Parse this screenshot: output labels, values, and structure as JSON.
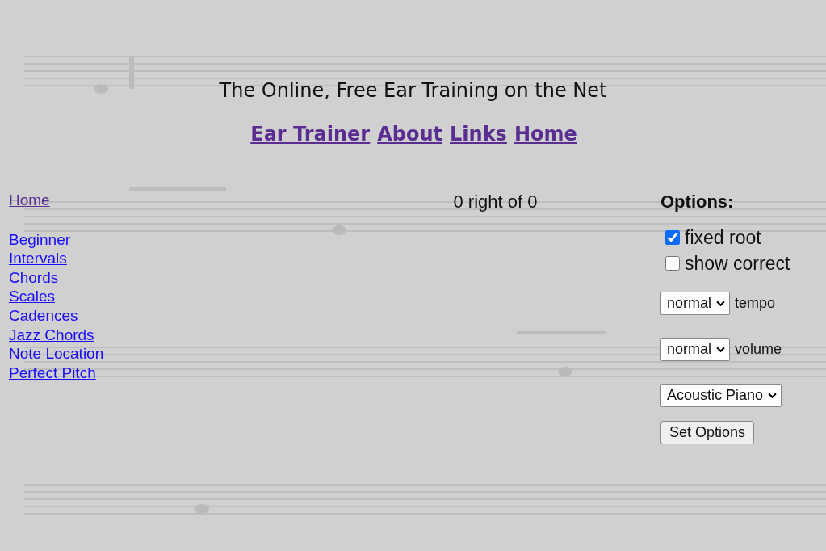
{
  "title": "The Online, Free Ear Training on the Net",
  "nav": [
    {
      "label": "Ear Trainer",
      "visited": true
    },
    {
      "label": "About",
      "visited": true
    },
    {
      "label": "Links",
      "visited": true
    },
    {
      "label": "Home",
      "visited": true
    }
  ],
  "sidebar": {
    "home": {
      "label": "Home",
      "visited": true
    },
    "items": [
      {
        "label": "Beginner",
        "visited": false
      },
      {
        "label": "Intervals",
        "visited": false
      },
      {
        "label": "Chords",
        "visited": false
      },
      {
        "label": "Scales",
        "visited": false
      },
      {
        "label": "Cadences",
        "visited": false
      },
      {
        "label": "Jazz Chords",
        "visited": false
      },
      {
        "label": "Note Location",
        "visited": false
      },
      {
        "label": "Perfect Pitch",
        "visited": false
      }
    ]
  },
  "score": "0 right of 0",
  "options": {
    "heading": "Options:",
    "checkboxes": [
      {
        "label": "fixed root",
        "checked": true
      },
      {
        "label": "show correct",
        "checked": false
      }
    ],
    "selects": [
      {
        "value": "normal",
        "label": "tempo"
      },
      {
        "value": "normal",
        "label": "volume"
      },
      {
        "value": "Acoustic Piano"
      }
    ],
    "button": "Set Options"
  }
}
